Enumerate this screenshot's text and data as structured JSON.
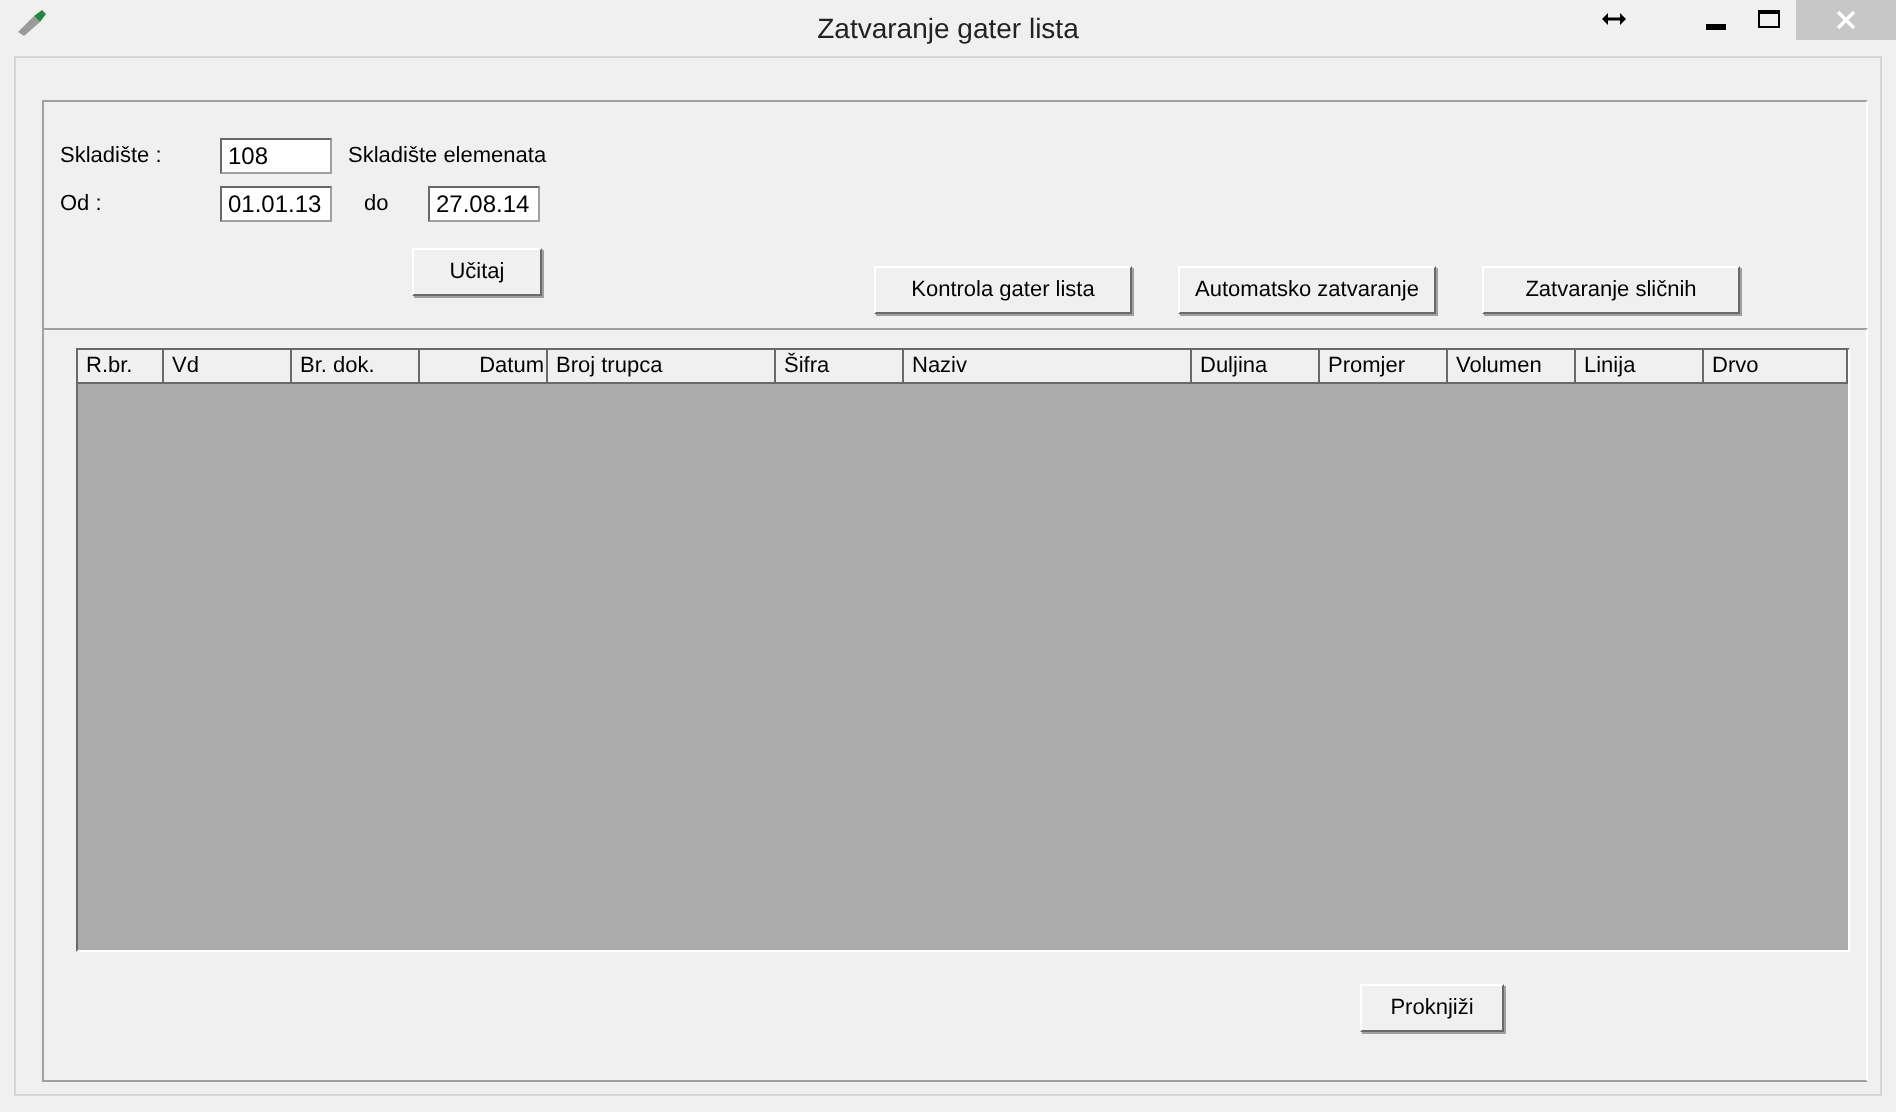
{
  "window": {
    "title": "Zatvaranje gater lista"
  },
  "filter": {
    "warehouse": {
      "label": "Skladište :",
      "value": "108",
      "description": "Skladište elemenata"
    },
    "from": {
      "label": "Od :",
      "value": "01.01.13"
    },
    "to": {
      "label": "do",
      "value": "27.08.14"
    },
    "load_button": "Učitaj"
  },
  "actions": [
    "Kontrola gater lista",
    "Automatsko zatvaranje",
    "Zatvaranje sličnih"
  ],
  "table": {
    "columns": [
      {
        "label": "R.br.",
        "kind": "text"
      },
      {
        "label": "Vd",
        "kind": "text"
      },
      {
        "label": "Br. dok.",
        "kind": "text"
      },
      {
        "label": "Datum",
        "kind": "date"
      },
      {
        "label": "Broj trupca",
        "kind": "text"
      },
      {
        "label": "Šifra",
        "kind": "text"
      },
      {
        "label": "Naziv",
        "kind": "text"
      },
      {
        "label": "Duljina",
        "kind": "text"
      },
      {
        "label": "Promjer",
        "kind": "text"
      },
      {
        "label": "Volumen",
        "kind": "text"
      },
      {
        "label": "Linija",
        "kind": "text"
      },
      {
        "label": "Drvo",
        "kind": "text"
      }
    ]
  },
  "post_button": "Proknjiži"
}
